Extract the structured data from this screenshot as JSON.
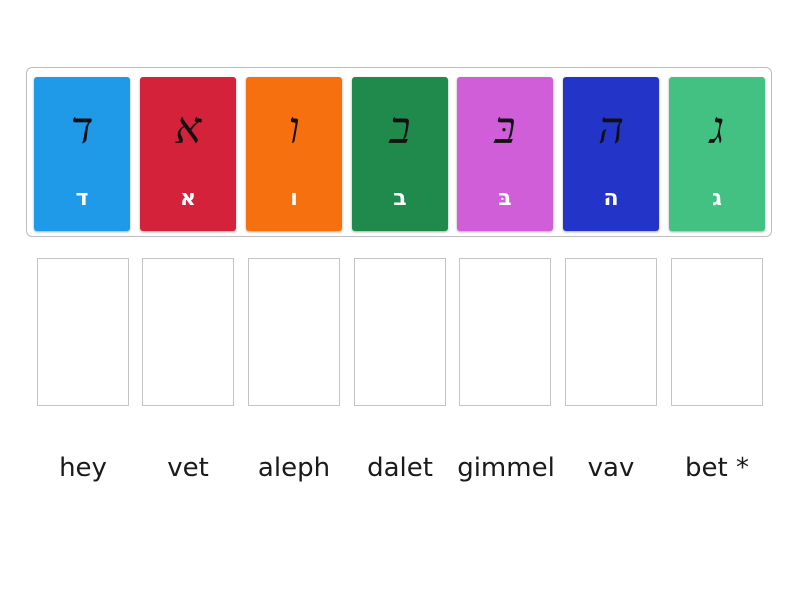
{
  "cards": [
    {
      "script": "ד",
      "letter": "ד",
      "color": "#1f9ae8"
    },
    {
      "script": "א",
      "letter": "א",
      "color": "#d4223a"
    },
    {
      "script": "ו",
      "letter": "ו",
      "color": "#f77010"
    },
    {
      "script": "ב",
      "letter": "ב",
      "color": "#1f8a4c"
    },
    {
      "script": "בּ",
      "letter": "בּ",
      "color": "#cf5ed8"
    },
    {
      "script": "ה",
      "letter": "ה",
      "color": "#2334c9"
    },
    {
      "script": "ג",
      "letter": "ג",
      "color": "#43c182"
    }
  ],
  "labels": [
    "hey",
    "vet",
    "aleph",
    "dalet",
    "gimmel",
    "vav",
    "bet *"
  ]
}
